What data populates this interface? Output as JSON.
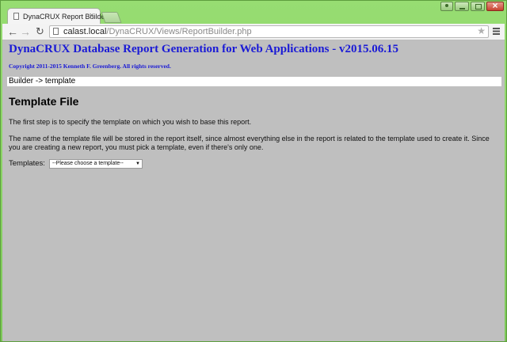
{
  "browser": {
    "tab_title": "DynaCRUX Report Builder",
    "tab_close": "×",
    "address_host": "calast.local",
    "address_path": "/DynaCRUX/Views/ReportBuilder.php",
    "nav_back": "←",
    "nav_forward": "→",
    "nav_reload": "↻",
    "star": "★",
    "icons": [
      "page-icon",
      "close-icon",
      "back-icon",
      "forward-icon",
      "reload-icon",
      "star-icon",
      "menu-icon",
      "user-icon",
      "minimize-icon",
      "maximize-icon",
      "window-close-icon"
    ]
  },
  "page": {
    "app_title": "DynaCRUX Database Report Generation for Web Applications - v2015.06.15",
    "copyright": "Copyright 2011-2015 Kenneth F. Greenberg. All rights reserved.",
    "breadcrumb": "Builder -> template",
    "heading": "Template File",
    "paragraph_1": "The first step is to specify the template on which you wish to base this report.",
    "paragraph_2": "The name of the template file will be stored in the report itself, since almost everything else in the report is related to the template used to create it. Since you are creating a new report, you must pick a template, even if there's only one.",
    "templates_label": "Templates:",
    "templates_selected": "--Please choose a template--",
    "dropdown_arrow": "▼"
  },
  "colors": {
    "page_background": "#bfbfbf",
    "title_blue": "#1a1ad6",
    "frame_green": "#8fd66a"
  }
}
